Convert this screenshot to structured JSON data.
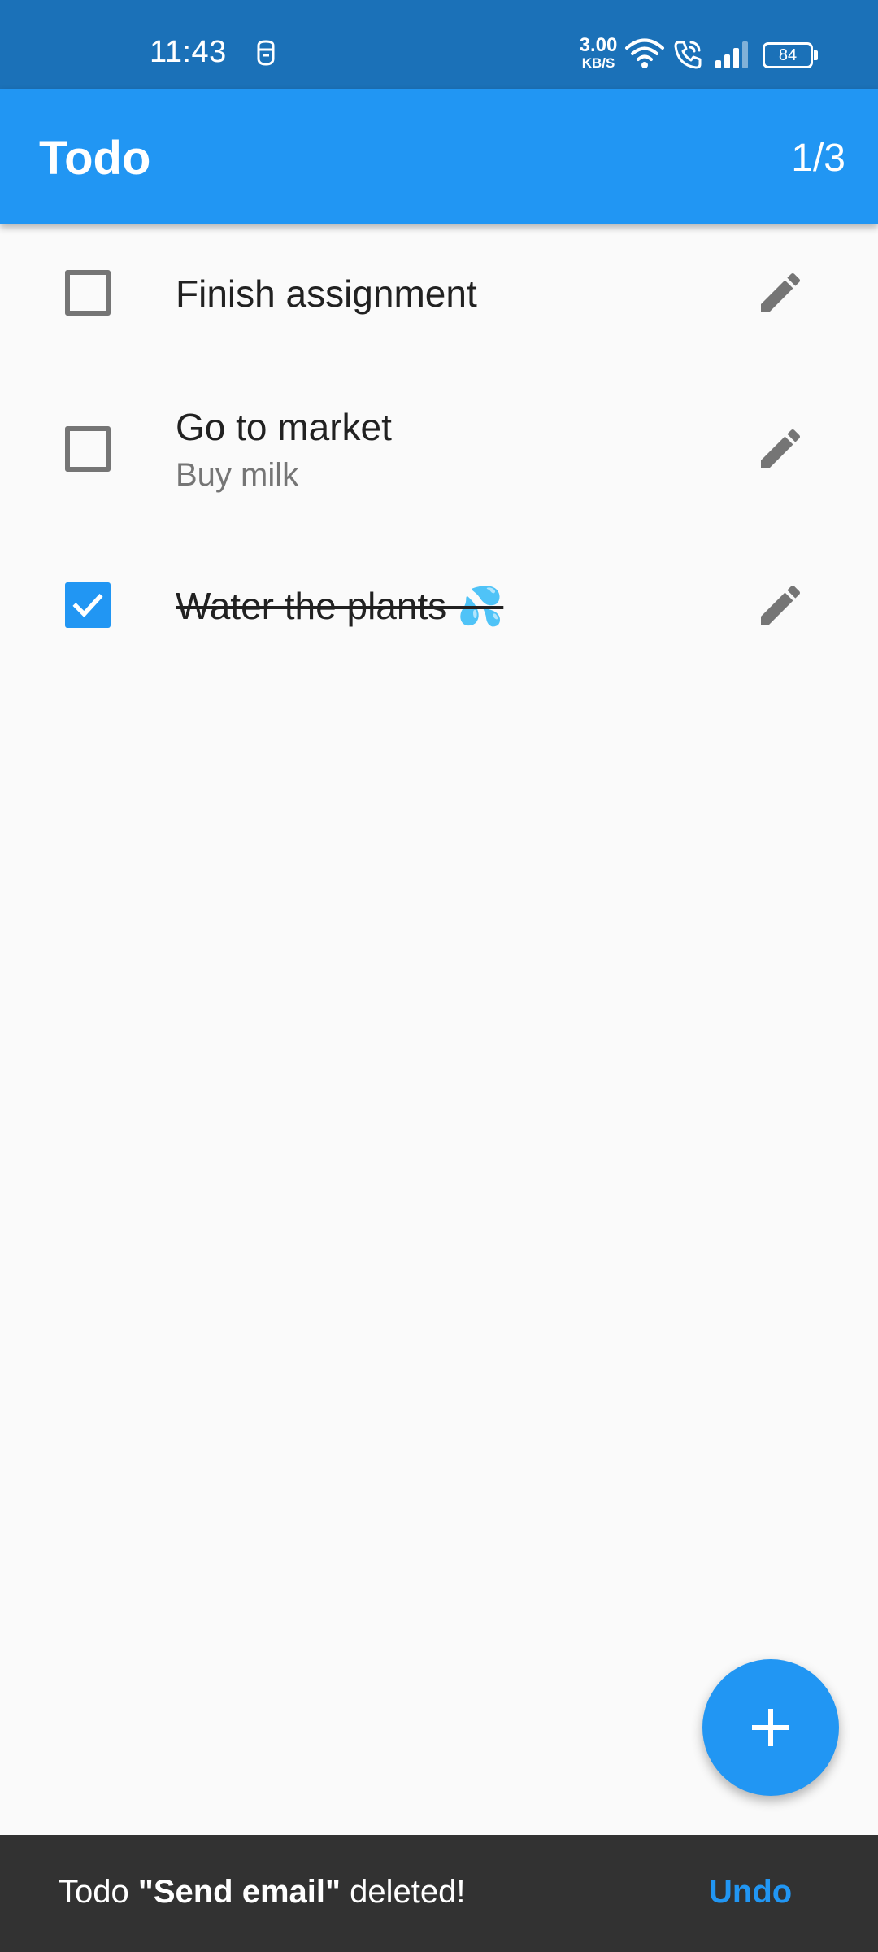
{
  "status_bar": {
    "time": "11:43",
    "net_speed_value": "3.00",
    "net_speed_unit": "KB/S",
    "battery": "84"
  },
  "app_bar": {
    "title": "Todo",
    "counter": "1/3"
  },
  "todos": [
    {
      "title": "Finish assignment",
      "subtitle": "",
      "checked": false
    },
    {
      "title": "Go to market",
      "subtitle": "Buy milk",
      "checked": false
    },
    {
      "title": "Water the plants 💦",
      "subtitle": "",
      "checked": true
    }
  ],
  "snackbar": {
    "prefix": "Todo ",
    "item": "\"Send email\"",
    "suffix": " deleted!",
    "action": "Undo"
  },
  "colors": {
    "status_bar": "#1b71b8",
    "primary": "#2196f3",
    "background": "#fafafa",
    "snackbar": "#323232"
  },
  "icons": {
    "fab": "add-icon",
    "row_action": "edit-icon"
  }
}
